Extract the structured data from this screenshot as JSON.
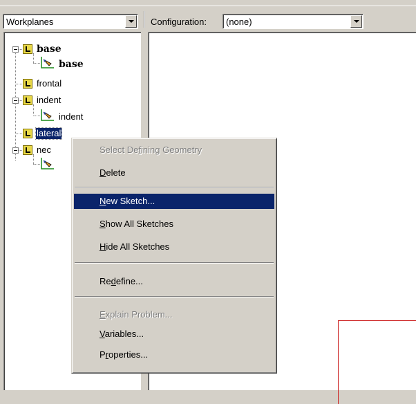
{
  "left_combo": {
    "value": "Workplanes"
  },
  "config": {
    "label": "Configuration:",
    "value": "(none)"
  },
  "tree": [
    {
      "label": "base",
      "bold": true
    },
    {
      "label": "base",
      "bold": true
    },
    {
      "label": "frontal"
    },
    {
      "label": "indent"
    },
    {
      "label": "indent"
    },
    {
      "label": "lateral",
      "selected": true
    },
    {
      "label": "nec"
    }
  ],
  "menu": {
    "select_defining": {
      "pre": "Select De",
      "ul": "f",
      "post": "ining Geometry"
    },
    "delete": {
      "pre": "",
      "ul": "D",
      "post": "elete"
    },
    "new_sketch": {
      "pre": "",
      "ul": "N",
      "post": "ew Sketch..."
    },
    "show_all": {
      "pre": "",
      "ul": "S",
      "post": "how All Sketches"
    },
    "hide_all": {
      "pre": "",
      "ul": "H",
      "post": "ide All Sketches"
    },
    "redefine": {
      "pre": "Re",
      "ul": "d",
      "post": "efine..."
    },
    "explain": {
      "pre": "",
      "ul": "E",
      "post": "xplain Problem..."
    },
    "variables": {
      "pre": "",
      "ul": "V",
      "post": "ariables..."
    },
    "properties": {
      "pre": "P",
      "ul": "r",
      "post": "operties..."
    }
  },
  "colors": {
    "highlight": "#0a246a",
    "face": "#d4d0c8",
    "sketch_red": "#cc2020"
  }
}
